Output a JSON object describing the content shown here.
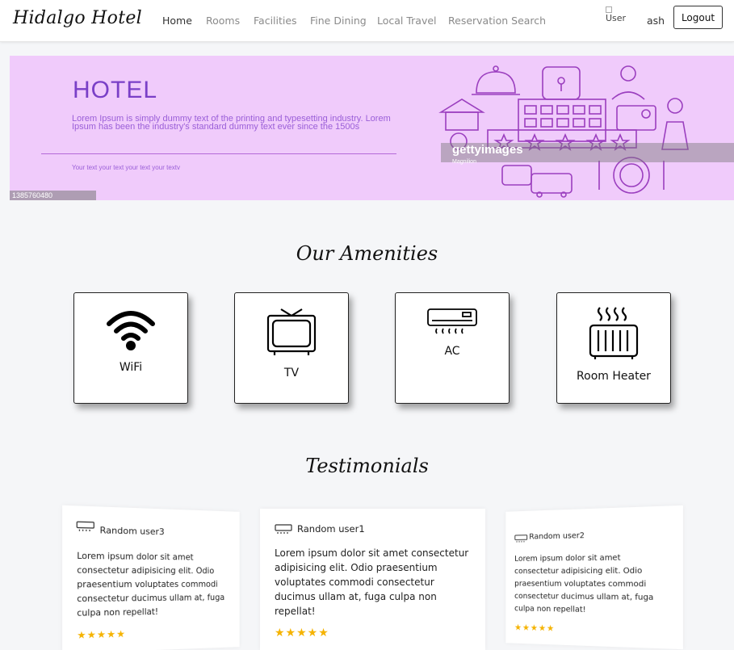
{
  "nav": {
    "brand": "Hidalgo Hotel",
    "links": [
      "Home",
      "Rooms",
      "Facilities",
      "Fine Dining",
      "Local Travel",
      "Reservation Search"
    ],
    "user_img_alt": "User",
    "user_name": "ash",
    "logout_label": "Logout"
  },
  "hero": {
    "title": "HOTEL",
    "text": "Lorem Ipsum is simply dummy text of the printing and typesetting industry. Lorem Ipsum has been the industry's standard dummy text ever since the 1500s",
    "subtext": "Your text your text your text your textv",
    "image_id": "1385760480",
    "watermark": "gettyimages",
    "watermark_credit": "Magnilion"
  },
  "amenities": {
    "title": "Our Amenities",
    "items": [
      {
        "label": "WiFi",
        "icon": "wifi-icon"
      },
      {
        "label": "TV",
        "icon": "tv-icon"
      },
      {
        "label": "AC",
        "icon": "ac-icon"
      },
      {
        "label": "Room Heater",
        "icon": "heater-icon"
      }
    ]
  },
  "testimonials": {
    "title": "Testimonials",
    "items": [
      {
        "user": "Random user3",
        "text": "Lorem ipsum dolor sit amet consectetur adipisicing elit. Odio praesentium voluptates commodi consectetur ducimus ullam at, fuga culpa non repellat!",
        "rating": 5,
        "stars": "★★★★★"
      },
      {
        "user": "Random user1",
        "text": "Lorem ipsum dolor sit amet consectetur adipisicing elit. Odio praesentium voluptates commodi consectetur ducimus ullam at, fuga culpa non repellat!",
        "rating": 5,
        "stars": "★★★★★"
      },
      {
        "user": "Random user2",
        "text": "Lorem ipsum dolor sit amet consectetur adipisicing elit. Odio praesentium voluptates commodi consectetur ducimus ullam at, fuga culpa non repellat!",
        "rating": 5,
        "stars": "★★★★★"
      }
    ]
  },
  "colors": {
    "hero_bg": "#f0cbfb",
    "hero_accent": "#7a3fc7",
    "star": "#f5b301"
  }
}
